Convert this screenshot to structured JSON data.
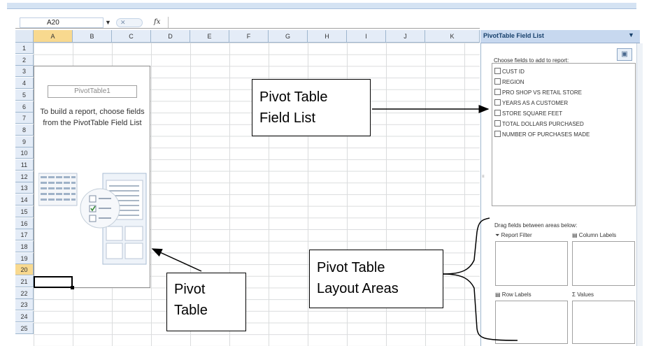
{
  "formula_bar": {
    "name_box": "A20",
    "fx": "fx"
  },
  "grid": {
    "columns": [
      "A",
      "B",
      "C",
      "D",
      "E",
      "F",
      "G",
      "H",
      "I",
      "J",
      "K"
    ],
    "rows": [
      "1",
      "2",
      "3",
      "4",
      "5",
      "6",
      "7",
      "8",
      "9",
      "10",
      "11",
      "12",
      "13",
      "14",
      "15",
      "16",
      "17",
      "18",
      "19",
      "20",
      "21",
      "22",
      "23",
      "24",
      "25"
    ],
    "active_cell": "A20"
  },
  "pivot_placeholder": {
    "name": "PivotTable1",
    "instructions": "To build a report, choose fields from the PivotTable Field List"
  },
  "field_list_pane": {
    "title": "PivotTable Field List",
    "instruction": "Choose fields to add to report:",
    "fields": [
      "CUST ID",
      "REGION",
      "PRO SHOP VS RETAIL STORE",
      "YEARS AS A CUSTOMER",
      "STORE SQUARE FEET",
      "TOTAL DOLLARS PURCHASED",
      "NUMBER OF PURCHASES MADE"
    ],
    "drag_instruction": "Drag fields between areas below:",
    "areas": {
      "report_filter": "Report Filter",
      "column_labels": "Column Labels",
      "row_labels": "Row Labels",
      "values": "Values"
    }
  },
  "callouts": {
    "field_list": [
      "Pivot Table",
      "Field List"
    ],
    "pivot_table": [
      "Pivot",
      "Table"
    ],
    "layout_areas": [
      "Pivot Table",
      "Layout Areas"
    ]
  },
  "icons": {
    "dropdown": "chevron-down-icon",
    "fx": "function-icon",
    "filter": "filter-icon",
    "columns": "column-labels-icon",
    "rows": "row-labels-icon",
    "values": "sigma-icon",
    "layout": "layout-icon"
  }
}
